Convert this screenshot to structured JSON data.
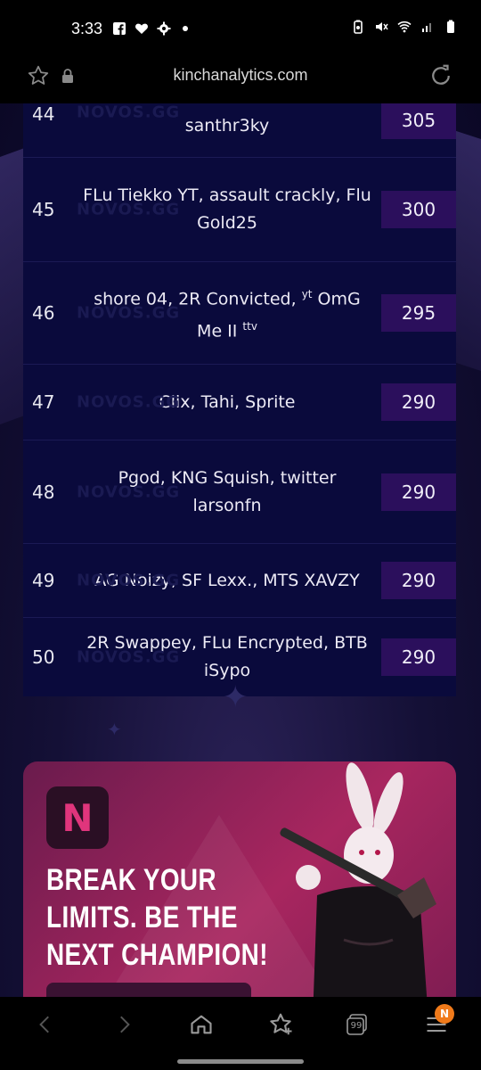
{
  "status_bar": {
    "time": "3:33"
  },
  "browser": {
    "url": "kinchanalytics.com"
  },
  "leaderboard": {
    "watermark": "NOVOS.GG",
    "rows": [
      {
        "rank": "44",
        "names": "santhr3ky",
        "points": "305"
      },
      {
        "rank": "45",
        "names": "FLu Tiekko YT, assault crackly, Flu Gold25",
        "points": "300"
      },
      {
        "rank": "46",
        "names_html_parts": [
          "shore 04, 2R Convicted, ",
          "yt",
          " OmG Me II ",
          "ttv"
        ],
        "points": "295"
      },
      {
        "rank": "47",
        "names": "Clix, Tahi, Sprite",
        "points": "290"
      },
      {
        "rank": "48",
        "names": "Pgod, KNG Squish, twitter larsonfn",
        "points": "290"
      },
      {
        "rank": "49",
        "names": "AG Noizy, SF Lexx., MTS XAVZY",
        "points": "290"
      },
      {
        "rank": "50",
        "names": "2R Swappey, FLu Encrypted, BTB iSypo",
        "points": "290"
      }
    ]
  },
  "ad": {
    "logo_letter": "N",
    "headline_lines": [
      "BREAK YOUR",
      "LIMITS. BE THE",
      "NEXT CHAMPION!"
    ]
  },
  "bottom_nav": {
    "badge": "N",
    "tabs_count": "99"
  },
  "colors": {
    "accent_points": "#2b0f5c",
    "ad_bg": "#a8265f",
    "badge": "#f07a1a"
  }
}
